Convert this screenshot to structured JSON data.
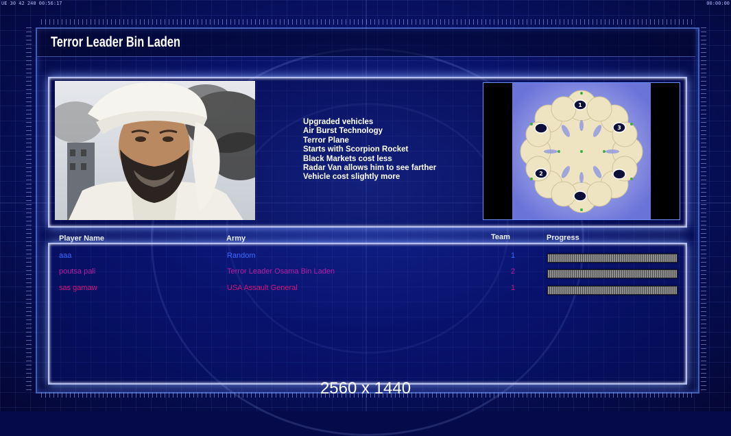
{
  "hud": {
    "top_left": "UE 30 42 240 00:56:17",
    "top_right": "00:00:00"
  },
  "title": "Terror Leader Bin Laden",
  "features": [
    "Upgraded vehicles",
    "Air Burst Technology",
    "Terror Plane",
    "Starts with Scorpion Rocket",
    "Black Markets cost less",
    "Radar Van allows him to see farther",
    "Vehicle cost slightly more"
  ],
  "map": {
    "start_positions": [
      "1",
      "2",
      "3"
    ]
  },
  "table": {
    "headers": {
      "player_name": "Player Name",
      "army": "Army",
      "team": "Team",
      "progress": "Progress"
    },
    "rows": [
      {
        "name": "aaa",
        "army": "Random",
        "team": "1",
        "color": "#3a6cff",
        "progress": 1.0
      },
      {
        "name": "poutsa pali",
        "army": "Terror Leader Osama Bin Laden",
        "team": "2",
        "color": "#b81ea0",
        "progress": 1.0
      },
      {
        "name": "sas gamaw",
        "army": "USA Assault General",
        "team": "1",
        "color": "#d4157a",
        "progress": 1.0
      }
    ]
  },
  "resolution": "2560 x 1440",
  "colors": {
    "background": "#061060",
    "panel_border": "#c8d2ff",
    "text": "#ffffff"
  }
}
